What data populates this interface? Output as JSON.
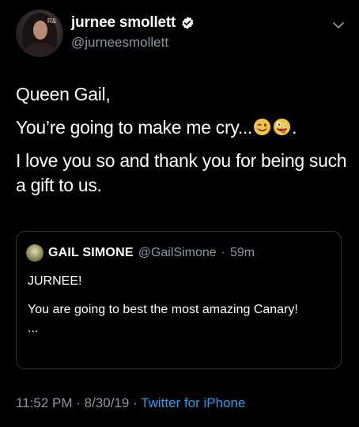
{
  "author": {
    "display_name": "jurnee smollett",
    "handle": "@jurneesmollett",
    "avatar_mark": "R&"
  },
  "tweet": {
    "line1": "Queen Gail,",
    "line2": "You’re going to make me cry...",
    "line2_end": ".",
    "line3": "I love you so and thank you for being such a gift to us."
  },
  "quote": {
    "name": "GAIL SIMONE",
    "handle": "@GailSimone",
    "dot": "·",
    "time": "59m",
    "line1": "JURNEE!",
    "line2": "You are going to best the most amazing Canary!",
    "ellipsis": "..."
  },
  "meta": {
    "time": "11:52 PM",
    "sep1": " · ",
    "date": "8/30/19",
    "sep2": " · ",
    "app": "Twitter for iPhone"
  },
  "icons": {
    "verified": "verified-badge-icon",
    "chevron": "chevron-down-icon",
    "emoji1": "winking-face-emoji",
    "emoji2": "zany-face-emoji"
  },
  "colors": {
    "background": "#000000",
    "text": "#ffffff",
    "secondary": "#8899a6",
    "link": "#1da1f2",
    "border": "#2f3336"
  }
}
